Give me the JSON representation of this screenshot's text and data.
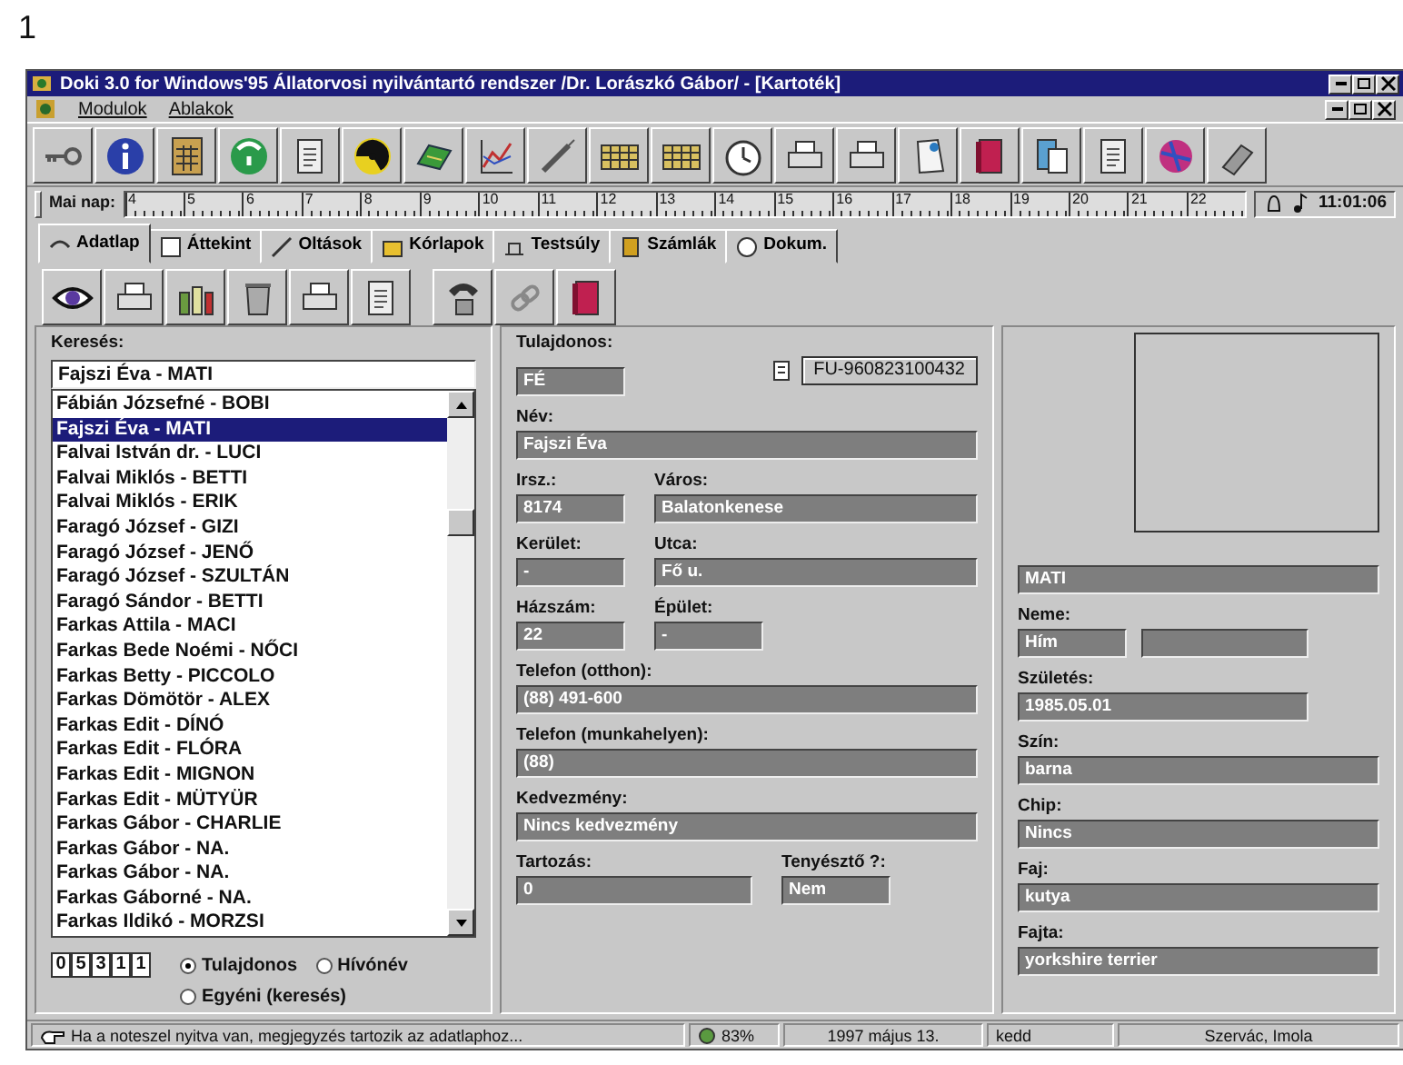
{
  "page_number": "1",
  "window": {
    "title": "Doki 3.0 for Windows'95 Állatorvosi nyilvántartó rendszer /Dr. Lorászkó Gábor/ - [Kartoték]",
    "menu": [
      "Modulok",
      "Ablakok"
    ]
  },
  "ruler": {
    "label": "Mai nap:",
    "days": [
      "4",
      "5",
      "6",
      "7",
      "8",
      "9",
      "10",
      "11",
      "12",
      "13",
      "14",
      "15",
      "16",
      "17",
      "18",
      "19",
      "20",
      "21",
      "22"
    ],
    "time": "11:01:06"
  },
  "tabs": [
    {
      "label": "Adatlap",
      "selected": true
    },
    {
      "label": "Áttekint",
      "selected": false
    },
    {
      "label": "Oltások",
      "selected": false
    },
    {
      "label": "Kórlapok",
      "selected": false
    },
    {
      "label": "Testsúly",
      "selected": false
    },
    {
      "label": "Számlák",
      "selected": false
    },
    {
      "label": "Dokum.",
      "selected": false
    }
  ],
  "search": {
    "label": "Keresés:",
    "value": "Fajszi Éva - MATI",
    "items": [
      {
        "text": "Fábián Józsefné - BOBI",
        "selected": false
      },
      {
        "text": "Fajszi Éva - MATI",
        "selected": true
      },
      {
        "text": "Falvai István dr. - LUCI",
        "selected": false
      },
      {
        "text": "Falvai Miklós - BETTI",
        "selected": false
      },
      {
        "text": "Falvai Miklós - ERIK",
        "selected": false
      },
      {
        "text": "Faragó József - GIZI",
        "selected": false
      },
      {
        "text": "Faragó József - JENŐ",
        "selected": false
      },
      {
        "text": "Faragó József - SZULTÁN",
        "selected": false
      },
      {
        "text": "Faragó Sándor - BETTI",
        "selected": false
      },
      {
        "text": "Farkas Attila - MACI",
        "selected": false
      },
      {
        "text": "Farkas Bede Noémi - NŐCI",
        "selected": false
      },
      {
        "text": "Farkas Betty - PICCOLO",
        "selected": false
      },
      {
        "text": "Farkas Dömötör - ALEX",
        "selected": false
      },
      {
        "text": "Farkas Edit - DÍNÓ",
        "selected": false
      },
      {
        "text": "Farkas Edit - FLÓRA",
        "selected": false
      },
      {
        "text": "Farkas Edit - MIGNON",
        "selected": false
      },
      {
        "text": "Farkas Edit - MÜTYÜR",
        "selected": false
      },
      {
        "text": "Farkas Gábor - CHARLIE",
        "selected": false
      },
      {
        "text": "Farkas Gábor - NA.",
        "selected": false
      },
      {
        "text": "Farkas Gábor - NA.",
        "selected": false
      },
      {
        "text": "Farkas Gáborné - NA.",
        "selected": false
      },
      {
        "text": "Farkas Ildikó - MORZSI",
        "selected": false
      }
    ],
    "counter": [
      "0",
      "5",
      "3",
      "1",
      "1"
    ],
    "modes": [
      {
        "label": "Tulajdonos",
        "selected": true
      },
      {
        "label": "Hívónév",
        "selected": false
      },
      {
        "label": "Egyéni (keresés)",
        "selected": false
      }
    ]
  },
  "owner": {
    "label": "Tulajdonos:",
    "code": "FÉ",
    "id": "FU-960823100432",
    "rows": [
      [
        {
          "label": "Név:",
          "value": "Fajszi Éva",
          "kind": "wide"
        }
      ],
      [
        {
          "label": "Irsz.:",
          "value": "8174",
          "kind": "short"
        },
        {
          "label": "Város:",
          "value": "Balatonkenese",
          "kind": "wide"
        }
      ],
      [
        {
          "label": "Kerület:",
          "value": "-",
          "kind": "short"
        },
        {
          "label": "Utca:",
          "value": "Fő u.",
          "kind": "wide"
        }
      ],
      [
        {
          "label": "Házszám:",
          "value": "22",
          "kind": "short"
        },
        {
          "label": "Épület:",
          "value": "-",
          "kind": "short"
        }
      ],
      [
        {
          "label": "Telefon (otthon):",
          "value": "(88) 491-600",
          "kind": "wide"
        }
      ],
      [
        {
          "label": "Telefon (munkahelyen):",
          "value": "(88)",
          "kind": "wide"
        }
      ],
      [
        {
          "label": "Kedvezmény:",
          "value": "Nincs kedvezmény",
          "kind": "wide"
        }
      ],
      [
        {
          "label": "Tartozás:",
          "value": "0",
          "kind": "medium"
        },
        {
          "label": "Tenyésztő ?:",
          "value": "Nem",
          "kind": "short"
        }
      ]
    ]
  },
  "animal": {
    "name": "MATI",
    "fields": [
      {
        "label": "Neme:",
        "value": "Hím",
        "kind": "pair"
      },
      {
        "label": "Születés:",
        "value": "1985.05.01",
        "kind": "medium"
      },
      {
        "label": "Szín:",
        "value": "barna",
        "kind": "wide"
      },
      {
        "label": "Chip:",
        "value": "Nincs",
        "kind": "wide"
      },
      {
        "label": "Faj:",
        "value": "kutya",
        "kind": "wide"
      },
      {
        "label": "Fajta:",
        "value": "yorkshire terrier",
        "kind": "wide"
      }
    ]
  },
  "status_bar": {
    "hint": "Ha a noteszel nyitva van, megjegyzés tartozik az adatlaphoz...",
    "percent": "83%",
    "date": "1997 május 13.",
    "weekday": "kedd",
    "nameday": "Szervác, Imola"
  }
}
